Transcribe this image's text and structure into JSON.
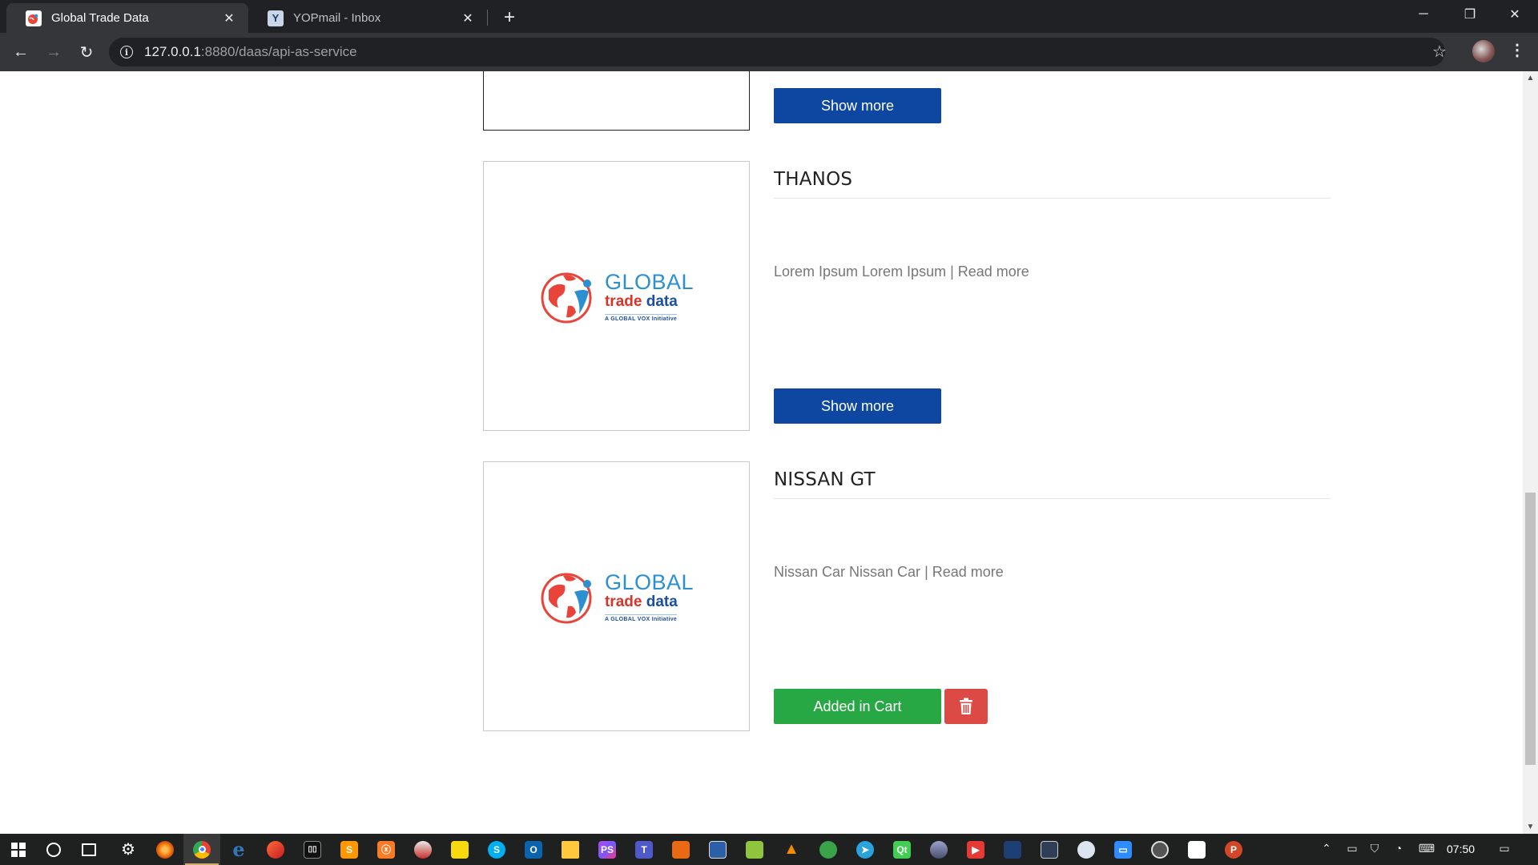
{
  "browser": {
    "tabs": [
      {
        "title": "Global Trade Data",
        "favicon": "global-trade-data-favicon",
        "active": true
      },
      {
        "title": "YOPmail - Inbox",
        "favicon": "yopmail-favicon",
        "active": false
      }
    ],
    "new_tab_icon": "+",
    "window_controls": {
      "minimize": "─",
      "restore": "❐",
      "close": "✕"
    },
    "address": {
      "host": "127.0.0.1",
      "path": ":8880/daas/api-as-service"
    },
    "info_icon": "i"
  },
  "page": {
    "partial_card": {
      "button_label": "Show more"
    },
    "logo": {
      "global": "GLOBAL",
      "trade_word1": "trade",
      "trade_word2": "data",
      "tagline": "A GLOBAL VOX Initiative"
    },
    "products": [
      {
        "title": "THANOS",
        "description": "Lorem Ipsum Lorem Ipsum ",
        "read_more": "| Read more",
        "button_label": "Show more"
      },
      {
        "title": "NISSAN GT",
        "description": "Nissan Car Nissan Car ",
        "read_more": "| Read more",
        "button_label": "Added in Cart",
        "delete_icon": "trash-icon"
      }
    ],
    "colors": {
      "show_more": "#0d47a1",
      "added_in_cart": "#28a745",
      "delete": "#dc4a46"
    }
  },
  "taskbar": {
    "clock": "07:50",
    "apps": [
      "windows-start",
      "cortana-search",
      "task-view",
      "settings",
      "firefox",
      "chrome",
      "edge",
      "app-red-swirl",
      "app-kindle",
      "sublime",
      "xampp",
      "app-cloud",
      "sticky-notes",
      "skype",
      "outlook",
      "file-explorer",
      "phpstorm",
      "teams",
      "app-orange",
      "app-blue-badge",
      "notepad-plus",
      "vlc",
      "app-green-circle",
      "telegram",
      "qt",
      "app-gray",
      "app-red-youtube",
      "app-dark-blue",
      "app-columns",
      "app-dashboard",
      "zoom",
      "app-circle",
      "app-white",
      "powerpoint"
    ]
  }
}
